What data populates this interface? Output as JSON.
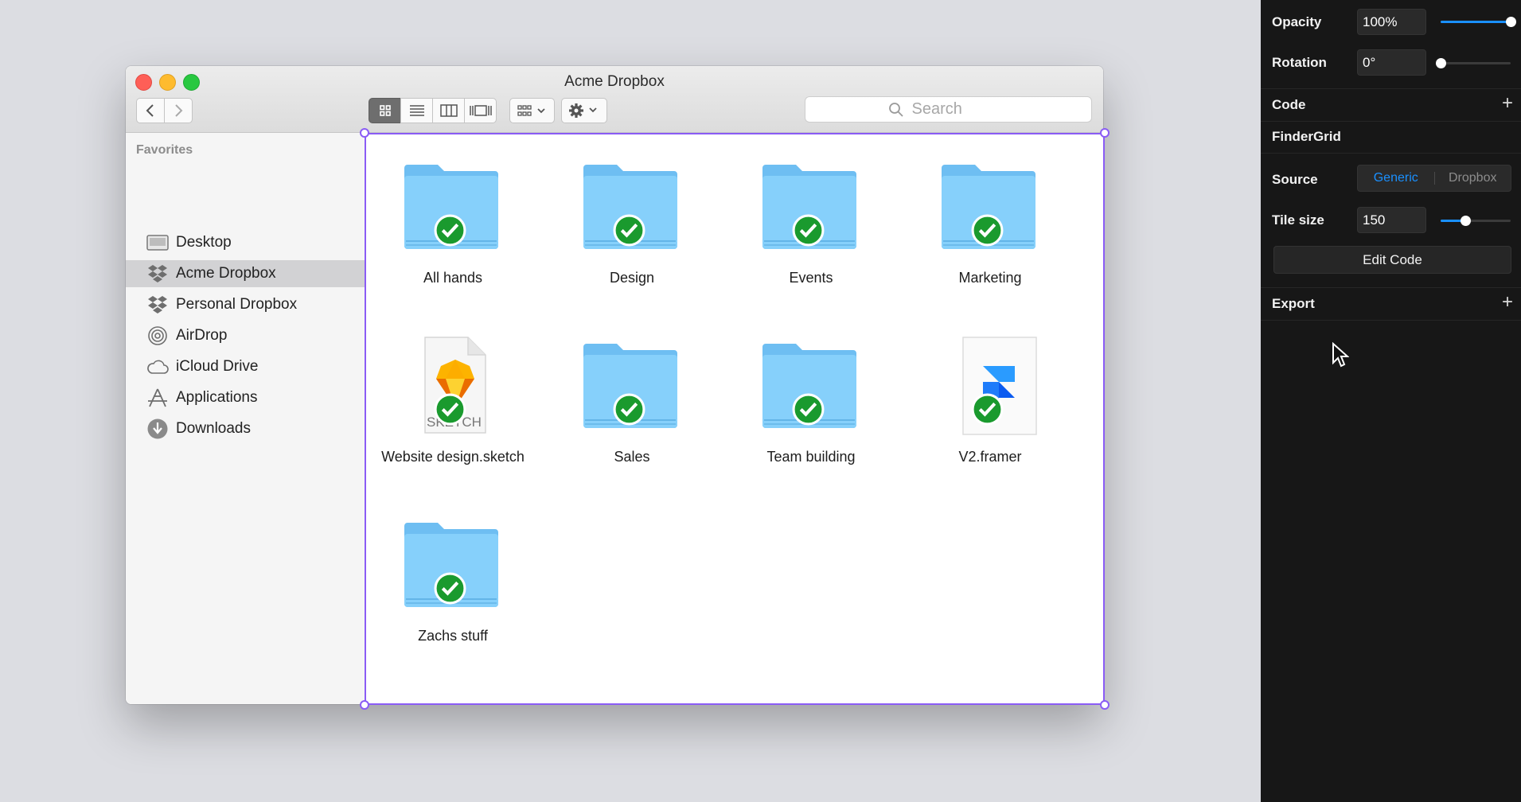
{
  "window": {
    "title": "Acme Dropbox",
    "search_placeholder": "Search",
    "view_modes": [
      "icon-view",
      "list-view",
      "column-view",
      "gallery-view"
    ],
    "active_view": "icon-view"
  },
  "sidebar": {
    "section_label": "Favorites",
    "items": [
      {
        "label": "Desktop",
        "icon": "desktop-icon"
      },
      {
        "label": "Acme Dropbox",
        "icon": "dropbox-icon",
        "selected": true
      },
      {
        "label": "Personal Dropbox",
        "icon": "dropbox-icon"
      },
      {
        "label": "AirDrop",
        "icon": "airdrop-icon"
      },
      {
        "label": "iCloud Drive",
        "icon": "icloud-icon"
      },
      {
        "label": "Applications",
        "icon": "applications-icon"
      },
      {
        "label": "Downloads",
        "icon": "downloads-icon"
      }
    ]
  },
  "files": [
    {
      "name": "All hands",
      "type": "folder",
      "synced": true
    },
    {
      "name": "Design",
      "type": "folder",
      "synced": true
    },
    {
      "name": "Events",
      "type": "folder",
      "synced": true
    },
    {
      "name": "Marketing",
      "type": "folder",
      "synced": true
    },
    {
      "name": "Website design.sketch",
      "type": "sketch-file",
      "icon_text": "SKETCH",
      "synced": true
    },
    {
      "name": "Sales",
      "type": "folder",
      "synced": true
    },
    {
      "name": "Team building",
      "type": "folder",
      "synced": true
    },
    {
      "name": "V2.framer",
      "type": "framer-file",
      "synced": true
    },
    {
      "name": "Zachs stuff",
      "type": "folder",
      "synced": true
    }
  ],
  "panel": {
    "opacity": {
      "label": "Opacity",
      "value": "100%",
      "level": 1.0
    },
    "rotation": {
      "label": "Rotation",
      "value": "0°",
      "level": 0.0
    },
    "code_section": "Code",
    "component_name": "FinderGrid",
    "source": {
      "label": "Source",
      "options": [
        "Generic",
        "Dropbox"
      ],
      "selected": "Generic"
    },
    "tile_size": {
      "label": "Tile size",
      "value": "150",
      "level": 0.35
    },
    "edit_code_label": "Edit Code",
    "export_section": "Export",
    "add_symbol": "+"
  },
  "colors": {
    "accent": "#1a90ff",
    "selection": "#8a5cf5",
    "sync_badge": "#1a9a2e",
    "folder": "#7ccaf7"
  }
}
